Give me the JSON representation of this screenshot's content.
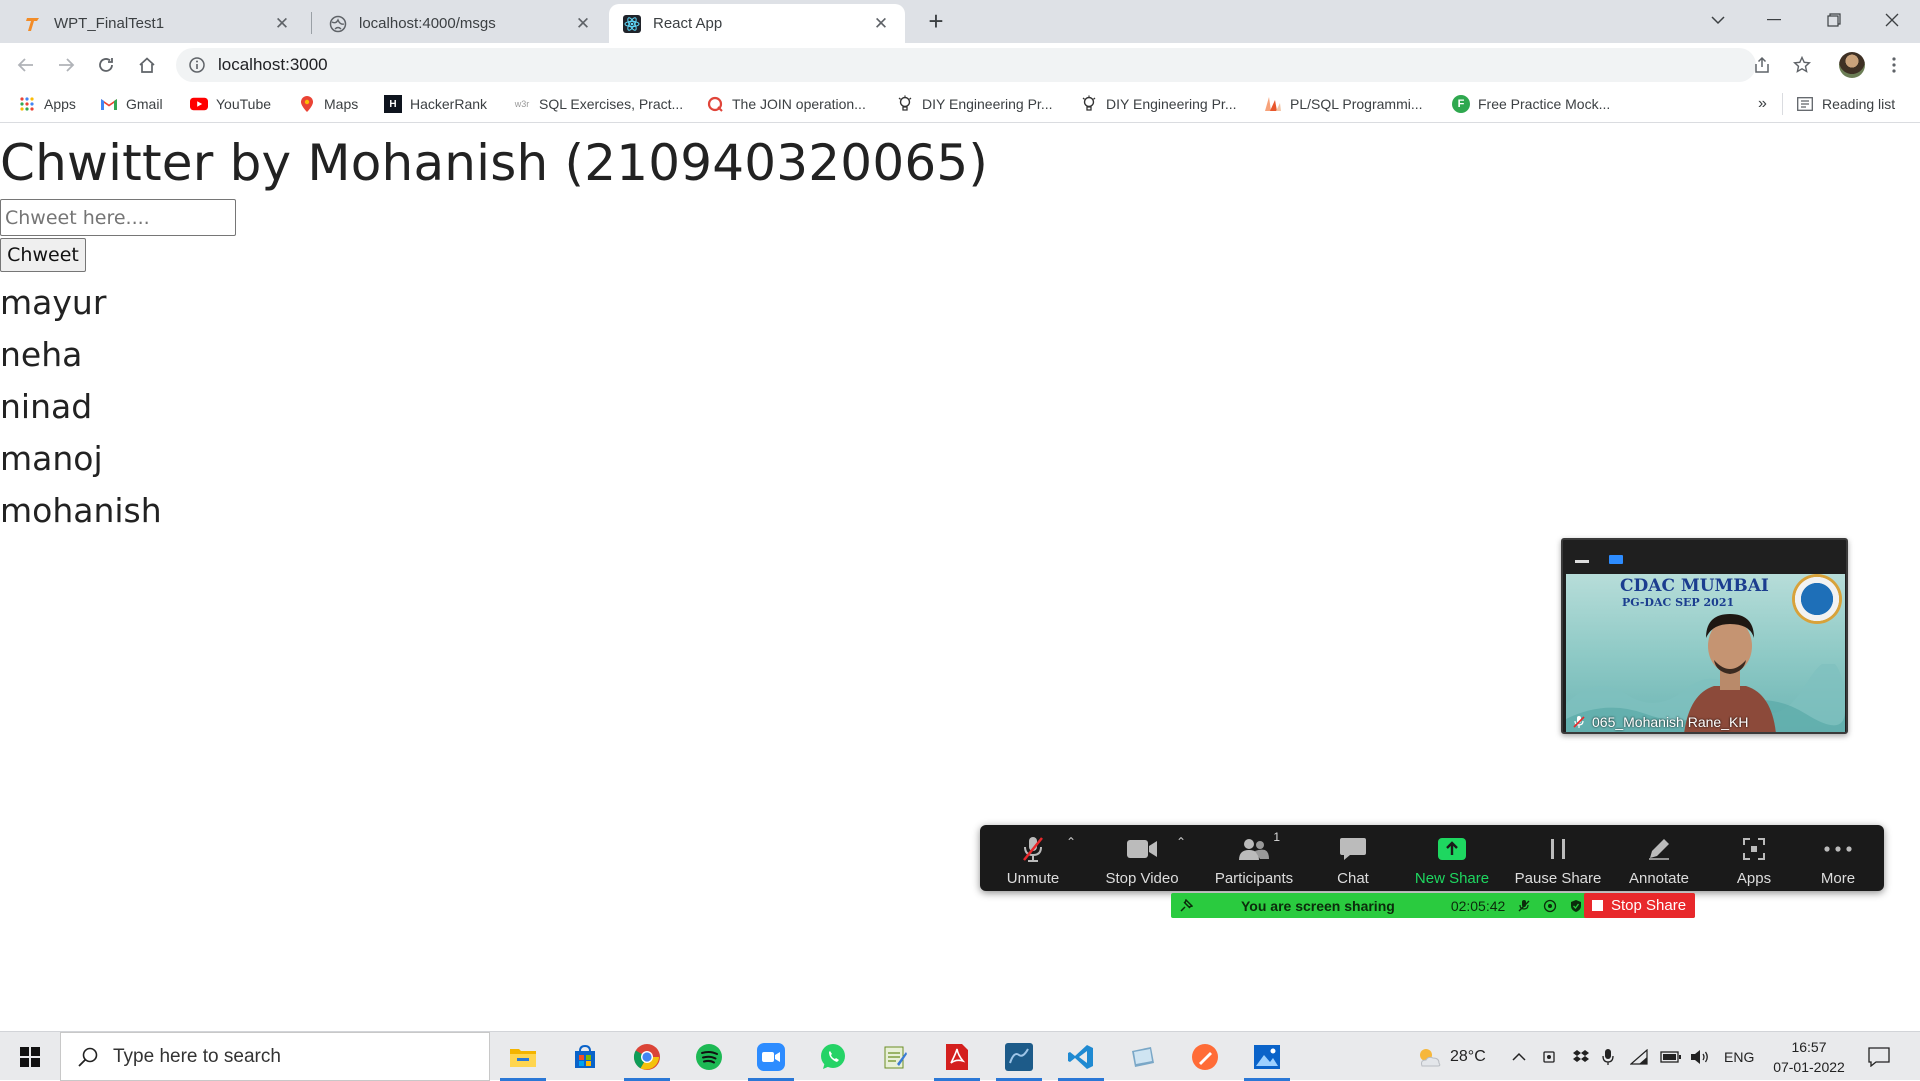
{
  "browser": {
    "tabs": [
      {
        "title": "WPT_FinalTest1",
        "icon": "testbook-icon",
        "active": false
      },
      {
        "title": "localhost:4000/msgs",
        "icon": "globe-icon",
        "active": false
      },
      {
        "title": "React App",
        "icon": "react-icon",
        "active": true
      }
    ],
    "url": "localhost:3000",
    "bookmarks": [
      {
        "label": "Apps",
        "icon": "apps-grid-icon"
      },
      {
        "label": "Gmail",
        "icon": "gmail-icon"
      },
      {
        "label": "YouTube",
        "icon": "youtube-icon"
      },
      {
        "label": "Maps",
        "icon": "maps-icon"
      },
      {
        "label": "HackerRank",
        "icon": "hackerrank-icon"
      },
      {
        "label": "SQL Exercises, Pract...",
        "icon": "w3resource-icon"
      },
      {
        "label": "The JOIN operation...",
        "icon": "sqlzoo-icon"
      },
      {
        "label": "DIY Engineering Pr...",
        "icon": "bulb-icon"
      },
      {
        "label": "DIY Engineering Pr...",
        "icon": "bulb-icon"
      },
      {
        "label": "PL/SQL Programmi...",
        "icon": "plsql-icon"
      },
      {
        "label": "Free Practice Mock...",
        "icon": "f-circle-icon"
      }
    ],
    "reading_list": "Reading list",
    "more_bookmarks": "»"
  },
  "app": {
    "title": "Chwitter by Mohanish (210940320065)",
    "input_placeholder": "Chweet here....",
    "input_value": "",
    "submit_label": "Chweet",
    "messages": [
      "mayur",
      "neha",
      "ninad",
      "manoj",
      "mohanish"
    ]
  },
  "zoom": {
    "video": {
      "participant_name": "065_Mohanish Rane_KH",
      "banner_line1": "CDAC MUMBAI",
      "banner_line2": "PG-DAC SEP 2021"
    },
    "controls": [
      {
        "label": "Unmute",
        "icon": "muted-mic-icon"
      },
      {
        "label": "Stop Video",
        "icon": "video-camera-icon"
      },
      {
        "label": "Participants",
        "icon": "participants-icon",
        "badge": "1"
      },
      {
        "label": "Chat",
        "icon": "chat-icon"
      },
      {
        "label": "New Share",
        "icon": "share-screen-icon"
      },
      {
        "label": "Pause Share",
        "icon": "pause-icon"
      },
      {
        "label": "Annotate",
        "icon": "pencil-icon"
      },
      {
        "label": "Apps",
        "icon": "apps-icon"
      },
      {
        "label": "More",
        "icon": "more-dots-icon"
      }
    ],
    "sharing_text": "You are screen sharing",
    "sharing_timer": "02:05:42",
    "stop_share_label": "Stop Share"
  },
  "taskbar": {
    "search_placeholder": "Type here to search",
    "pinned_apps": [
      "file-explorer-icon",
      "store-icon",
      "chrome-icon",
      "spotify-icon",
      "zoom-icon",
      "whatsapp-icon",
      "notepad-icon",
      "acrobat-icon",
      "mysql-workbench-icon",
      "vscode-icon",
      "app-icon",
      "postman-icon",
      "photos-icon"
    ],
    "weather": "28°C",
    "language": "ENG",
    "time": "16:57",
    "date": "07-01-2022"
  },
  "colors": {
    "zoom_green": "#2acb3f",
    "zoom_red": "#e8282b",
    "chrome_tab_bg": "#dee1e6"
  }
}
